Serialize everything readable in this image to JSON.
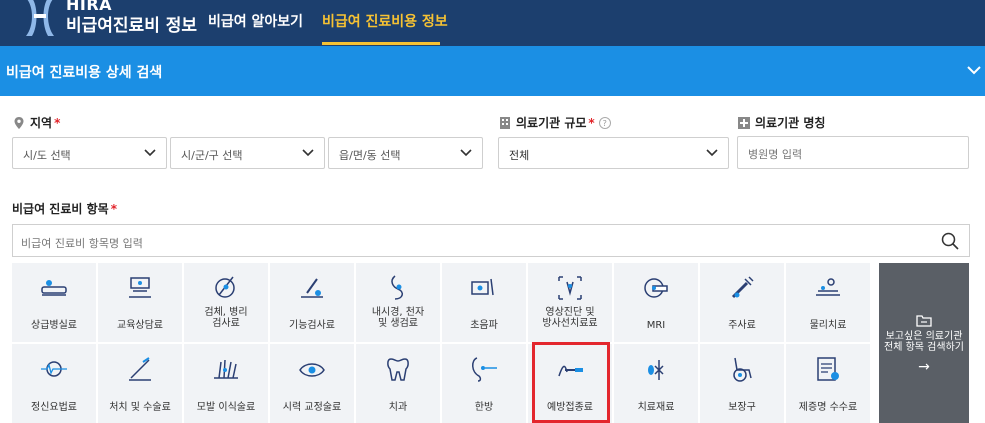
{
  "header": {
    "logo_hira": "HIRA",
    "logo_title": "비급여진료비 정보",
    "nav": [
      "비급여 알아보기",
      "비급여 진료비용 정보"
    ]
  },
  "search_bar": {
    "title": "비급여 진료비용 상세 검색"
  },
  "region": {
    "label": "지역",
    "required": "*",
    "sido": "시/도 선택",
    "sigungu": "시/군/구 선택",
    "eupmyeondong": "읍/면/동 선택"
  },
  "institution_size": {
    "label": "의료기관 규모",
    "required": "*",
    "help": "?",
    "value": "전체"
  },
  "institution_name": {
    "label": "의료기관 명칭",
    "placeholder": "병원명 입력"
  },
  "items": {
    "label": "비급여 진료비 항목",
    "required": "*",
    "placeholder": "비급여 진료비 항목명 입력"
  },
  "tiles": [
    {
      "label": "상급병실료",
      "icon": "bed-icon"
    },
    {
      "label": "교육상담료",
      "icon": "consultation-icon"
    },
    {
      "label": "검체, 병리\n검사료",
      "icon": "specimen-icon"
    },
    {
      "label": "기능검사료",
      "icon": "function-test-icon"
    },
    {
      "label": "내시경, 천자\n및 생검료",
      "icon": "endoscope-icon"
    },
    {
      "label": "초음파",
      "icon": "ultrasound-icon"
    },
    {
      "label": "영상진단 및\n방사선치료료",
      "icon": "imaging-icon"
    },
    {
      "label": "MRI",
      "icon": "mri-icon"
    },
    {
      "label": "주사료",
      "icon": "syringe-icon"
    },
    {
      "label": "물리치료",
      "icon": "physical-therapy-icon"
    },
    {
      "label": "정신요법료",
      "icon": "brain-wave-icon"
    },
    {
      "label": "처치 및 수술료",
      "icon": "scalpel-icon"
    },
    {
      "label": "모발 이식술료",
      "icon": "hair-icon"
    },
    {
      "label": "시력 교정술료",
      "icon": "eye-icon"
    },
    {
      "label": "치과",
      "icon": "tooth-icon"
    },
    {
      "label": "한방",
      "icon": "acupuncture-icon"
    },
    {
      "label": "예방접종료",
      "icon": "vaccine-icon"
    },
    {
      "label": "치료재료",
      "icon": "material-icon"
    },
    {
      "label": "보장구",
      "icon": "wheelchair-icon"
    },
    {
      "label": "제증명 수수료",
      "icon": "certificate-icon"
    }
  ],
  "full_search": {
    "text": "보고싶은 의료기관\n전체 항목 검색하기",
    "arrow": "→"
  },
  "colors": {
    "header": "#1c3f6e",
    "accent_bar": "#1b8fe4",
    "active_nav": "#f6c233",
    "highlight": "#e3262d"
  }
}
